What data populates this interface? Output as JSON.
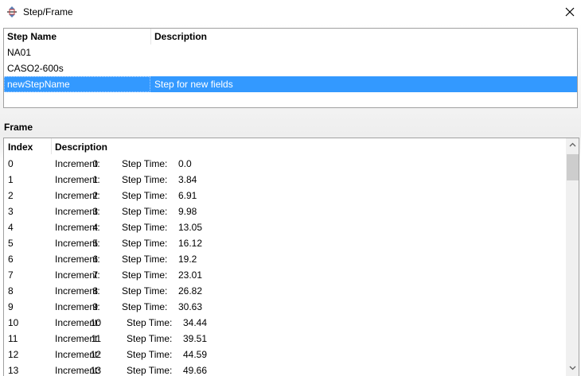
{
  "window": {
    "title": "Step/Frame",
    "icon": "step-frame-app-icon",
    "close_icon": "close-icon"
  },
  "step_table": {
    "columns": [
      "Step Name",
      "Description"
    ],
    "rows": [
      {
        "name": "NA01",
        "description": "",
        "selected": false
      },
      {
        "name": "CASO2-600s",
        "description": "",
        "selected": false
      },
      {
        "name": "newStepName",
        "description": "Step for new fields",
        "selected": true
      }
    ],
    "selection_color": "#3399ff"
  },
  "frame_section": {
    "label": "Frame",
    "columns": [
      "Index",
      "Description"
    ],
    "increment_label": "Increment:",
    "step_time_label": "Step Time:",
    "rows": [
      {
        "index": "0",
        "increment": "0",
        "step_time": "0.0"
      },
      {
        "index": "1",
        "increment": "1",
        "step_time": "3.84"
      },
      {
        "index": "2",
        "increment": "2",
        "step_time": "6.91"
      },
      {
        "index": "3",
        "increment": "3",
        "step_time": "9.98"
      },
      {
        "index": "4",
        "increment": "4",
        "step_time": "13.05"
      },
      {
        "index": "5",
        "increment": "5",
        "step_time": "16.12"
      },
      {
        "index": "6",
        "increment": "6",
        "step_time": "19.2"
      },
      {
        "index": "7",
        "increment": "7",
        "step_time": "23.01"
      },
      {
        "index": "8",
        "increment": "8",
        "step_time": "26.82"
      },
      {
        "index": "9",
        "increment": "9",
        "step_time": "30.63"
      },
      {
        "index": "10",
        "increment": "10",
        "step_time": "34.44"
      },
      {
        "index": "11",
        "increment": "11",
        "step_time": "39.51"
      },
      {
        "index": "12",
        "increment": "12",
        "step_time": "44.59"
      },
      {
        "index": "13",
        "increment": "13",
        "step_time": "49.66"
      }
    ],
    "scrollbar": {
      "up_icon": "scroll-up-arrow-icon",
      "down_icon": "scroll-down-arrow-icon"
    }
  }
}
